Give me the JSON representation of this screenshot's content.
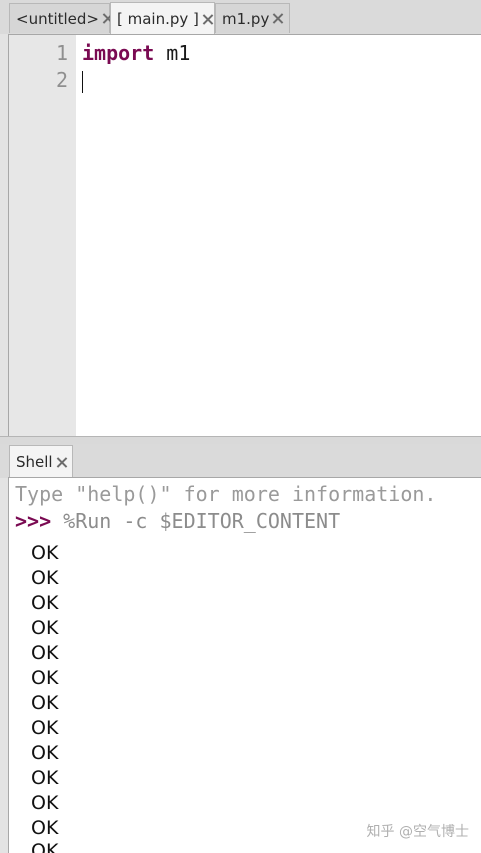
{
  "editor": {
    "tabs": [
      {
        "label": "<untitled>"
      },
      {
        "label": "[ main.py ]"
      },
      {
        "label": "m1.py"
      }
    ],
    "lines": [
      {
        "num": "1",
        "keyword": "import",
        "rest": " m1"
      },
      {
        "num": "2",
        "keyword": "",
        "rest": ""
      }
    ]
  },
  "shell": {
    "tab_label": "Shell",
    "intro": "Type \"help()\" for more information.",
    "prompt": ">>>",
    "command": " %Run -c $EDITOR_CONTENT",
    "output": [
      "OK",
      "OK",
      "OK",
      "OK",
      "OK",
      "OK",
      "OK",
      "OK",
      "OK",
      "OK",
      "OK",
      "OK",
      "OK"
    ]
  },
  "watermark": "知乎 @空气博士"
}
